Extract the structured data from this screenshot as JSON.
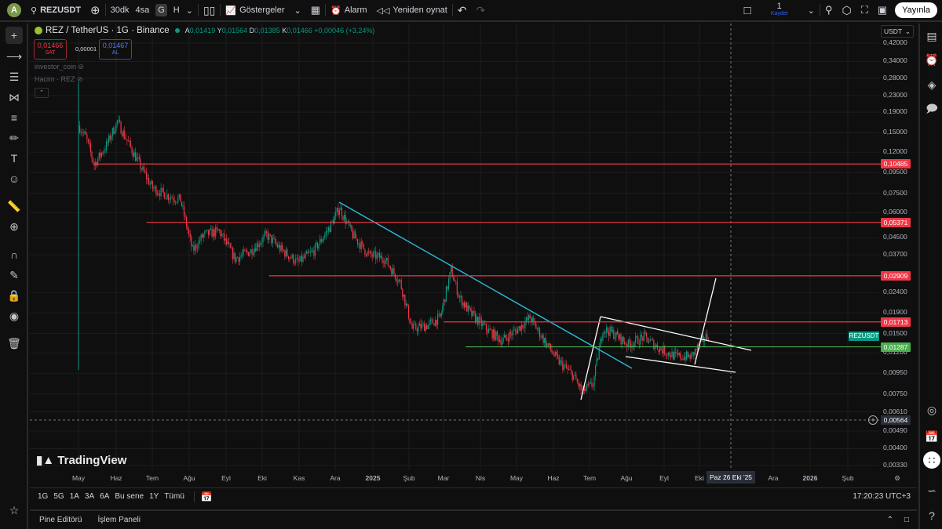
{
  "topbar": {
    "avatar": "A",
    "symbol": "REZUSDT",
    "intervals": [
      "30dk",
      "4sa",
      "G",
      "H"
    ],
    "indicators": "Göstergeler",
    "alarm": "Alarm",
    "replay": "Yeniden oynat",
    "save_count": "1",
    "save_label": "Kaydet",
    "publish": "Yayınla"
  },
  "legend": {
    "title": "REZ / TetherUS · 1G · Binance",
    "o_label": "A",
    "o": "0,01419",
    "h_label": "Y",
    "h": "0,01564",
    "l_label": "D",
    "l": "0,01385",
    "c_label": "K",
    "c": "0,01466",
    "change": "+0,00046 (+3,24%)",
    "sell_price": "0,01466",
    "sell_label": "SAT",
    "spread": "0,00001",
    "buy_price": "0,01467",
    "buy_label": "AL",
    "indicator1": "investor_coin",
    "indicator2": "Hacim · REZ"
  },
  "price_axis": {
    "currency": "USDT",
    "ticks": [
      "0,42000",
      "0,34000",
      "0,28000",
      "0,23000",
      "0,19000",
      "0,15000",
      "0,12000",
      "0,09500",
      "0,07500",
      "0,06000",
      "0,04500",
      "0,03700",
      "0,02400",
      "0,01900",
      "0,01500",
      "0,01200",
      "0,00950",
      "0,00750",
      "0,00610",
      "0,00490",
      "0,00400",
      "0,00330"
    ],
    "tick_values": [
      0.42,
      0.34,
      0.28,
      0.23,
      0.19,
      0.15,
      0.12,
      0.095,
      0.075,
      0.06,
      0.045,
      0.037,
      0.024,
      0.019,
      0.015,
      0.012,
      0.0095,
      0.0075,
      0.0061,
      0.0049,
      0.004,
      0.0033
    ],
    "levels": [
      {
        "label": "0,10485",
        "value": 0.10485,
        "color": "#f23645"
      },
      {
        "label": "0,05371",
        "value": 0.05371,
        "color": "#f23645"
      },
      {
        "label": "0,02909",
        "value": 0.02909,
        "color": "#f23645"
      },
      {
        "label": "0,01713",
        "value": 0.01713,
        "color": "#f23645"
      },
      {
        "label": "0,01287",
        "value": 0.01287,
        "color": "#4caf50"
      }
    ],
    "symbol_tag": "REZUSDT",
    "crosshair_price": "0,00564"
  },
  "time_axis": {
    "labels": [
      "May",
      "Haz",
      "Tem",
      "Ağu",
      "Eyl",
      "Eki",
      "Kas",
      "Ara",
      "2025",
      "Şub",
      "Mar",
      "Nis",
      "May",
      "Haz",
      "Tem",
      "Ağu",
      "Eyl",
      "Eki",
      "Ara",
      "2026",
      "Şub"
    ],
    "crosshair_date": "Paz 26 Eki '25"
  },
  "series_keypoints": [
    [
      0,
      0.163
    ],
    [
      6,
      0.143
    ],
    [
      13,
      0.104
    ],
    [
      23,
      0.13
    ],
    [
      32,
      0.171
    ],
    [
      42,
      0.13
    ],
    [
      52,
      0.0996
    ],
    [
      61,
      0.0796
    ],
    [
      74,
      0.0727
    ],
    [
      84,
      0.0695
    ],
    [
      94,
      0.0387
    ],
    [
      103,
      0.0464
    ],
    [
      116,
      0.0485
    ],
    [
      129,
      0.0354
    ],
    [
      142,
      0.0387
    ],
    [
      155,
      0.0464
    ],
    [
      168,
      0.0387
    ],
    [
      181,
      0.0338
    ],
    [
      194,
      0.0387
    ],
    [
      207,
      0.0507
    ],
    [
      215,
      0.0635
    ],
    [
      226,
      0.0464
    ],
    [
      239,
      0.037
    ],
    [
      252,
      0.0354
    ],
    [
      265,
      0.027
    ],
    [
      275,
      0.0158
    ],
    [
      288,
      0.0165
    ],
    [
      298,
      0.018
    ],
    [
      307,
      0.0309
    ],
    [
      314,
      0.0226
    ],
    [
      323,
      0.0189
    ],
    [
      336,
      0.0158
    ],
    [
      349,
      0.0138
    ],
    [
      362,
      0.0158
    ],
    [
      372,
      0.018
    ],
    [
      382,
      0.0144
    ],
    [
      395,
      0.011
    ],
    [
      408,
      0.0092
    ],
    [
      415,
      0.0077
    ],
    [
      424,
      0.0084
    ],
    [
      432,
      0.0158
    ],
    [
      440,
      0.0151
    ],
    [
      453,
      0.0132
    ],
    [
      466,
      0.0144
    ],
    [
      479,
      0.0126
    ],
    [
      492,
      0.0115
    ],
    [
      505,
      0.0115
    ],
    [
      514,
      0.0138
    ],
    [
      519,
      0.01466
    ]
  ],
  "colors": {
    "up": "#089981",
    "down": "#f23645",
    "trendline": "#29b6d6",
    "drawing": "#ffffff"
  },
  "range_bar": {
    "ranges": [
      "1G",
      "5G",
      "1A",
      "3A",
      "6A",
      "Bu sene",
      "1Y",
      "Tümü"
    ],
    "clock": "17:20:23 UTC+3"
  },
  "bottom_panel": {
    "tabs": [
      "Pine Editörü",
      "İşlem Paneli"
    ]
  },
  "logo": "TradingView"
}
